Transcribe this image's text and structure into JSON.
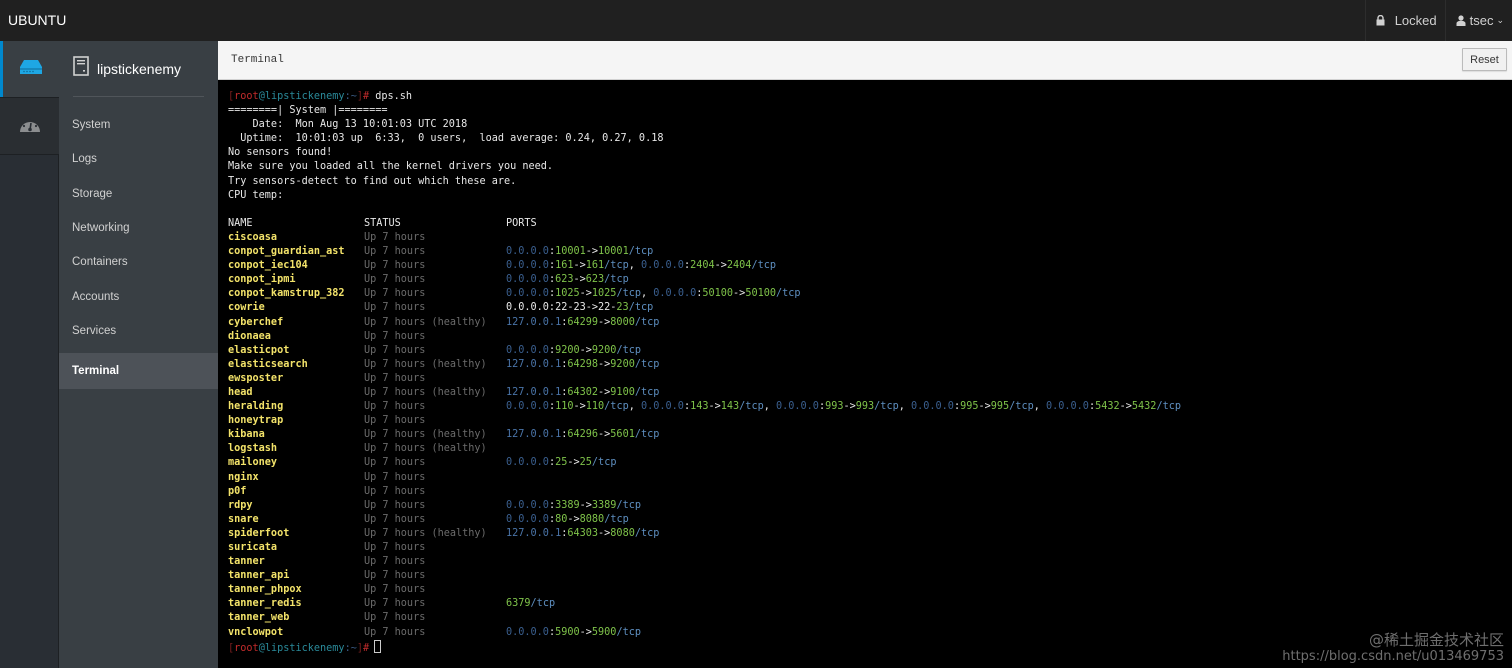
{
  "topbar": {
    "brand": "UBUNTU",
    "lock_label": "Locked",
    "user_label": "tsec"
  },
  "rail": {
    "items": [
      {
        "icon": "server-icon",
        "active": true
      },
      {
        "icon": "dashboard-icon",
        "active": false
      }
    ]
  },
  "nav": {
    "host": "lipstickenemy",
    "items": [
      {
        "label": "System"
      },
      {
        "label": "Logs"
      },
      {
        "label": "Storage"
      },
      {
        "label": "Networking"
      },
      {
        "label": "Containers"
      },
      {
        "label": "Accounts"
      },
      {
        "label": "Services"
      },
      {
        "label": "Terminal",
        "active": true
      }
    ]
  },
  "main": {
    "title": "Terminal",
    "reset_label": "Reset"
  },
  "terminal": {
    "prompt": {
      "user": "root",
      "host": "lipstickenemy",
      "path": "~",
      "symbol": "#"
    },
    "command": "dps.sh",
    "header_lines": [
      "========| System |========",
      "    Date:  Mon Aug 13 10:01:03 UTC 2018",
      "  Uptime:  10:01:03 up  6:33,  0 users,  load average: 0.24, 0.27, 0.18",
      "No sensors found!",
      "Make sure you loaded all the kernel drivers you need.",
      "Try sensors-detect to find out which these are.",
      "CPU temp:",
      ""
    ],
    "columns": {
      "name": "NAME",
      "status": "STATUS",
      "ports": "PORTS"
    },
    "containers": [
      {
        "name": "ciscoasa",
        "status": "Up 7 hours",
        "ports": []
      },
      {
        "name": "conpot_guardian_ast",
        "status": "Up 7 hours",
        "ports": [
          {
            "ip": "0.0.0.0",
            "host": "10001",
            "ctr": "10001",
            "proto": "tcp"
          }
        ]
      },
      {
        "name": "conpot_iec104",
        "status": "Up 7 hours",
        "ports": [
          {
            "ip": "0.0.0.0",
            "host": "161",
            "ctr": "161",
            "proto": "tcp"
          },
          {
            "ip": "0.0.0.0",
            "host": "2404",
            "ctr": "2404",
            "proto": "tcp"
          }
        ]
      },
      {
        "name": "conpot_ipmi",
        "status": "Up 7 hours",
        "ports": [
          {
            "ip": "0.0.0.0",
            "host": "623",
            "ctr": "623",
            "proto": "tcp"
          }
        ]
      },
      {
        "name": "conpot_kamstrup_382",
        "status": "Up 7 hours",
        "ports": [
          {
            "ip": "0.0.0.0",
            "host": "1025",
            "ctr": "1025",
            "proto": "tcp"
          },
          {
            "ip": "0.0.0.0",
            "host": "50100",
            "ctr": "50100",
            "proto": "tcp"
          }
        ]
      },
      {
        "name": "cowrie",
        "status": "Up 7 hours",
        "raw_ports": "0.0.0.0:22-23->22-23/tcp"
      },
      {
        "name": "cyberchef",
        "status": "Up 7 hours (healthy)",
        "ports": [
          {
            "ip": "127.0.0.1",
            "host": "64299",
            "ctr": "8000",
            "proto": "tcp"
          }
        ]
      },
      {
        "name": "dionaea",
        "status": "Up 7 hours",
        "ports": []
      },
      {
        "name": "elasticpot",
        "status": "Up 7 hours",
        "ports": [
          {
            "ip": "0.0.0.0",
            "host": "9200",
            "ctr": "9200",
            "proto": "tcp"
          }
        ]
      },
      {
        "name": "elasticsearch",
        "status": "Up 7 hours (healthy)",
        "ports": [
          {
            "ip": "127.0.0.1",
            "host": "64298",
            "ctr": "9200",
            "proto": "tcp"
          }
        ]
      },
      {
        "name": "ewsposter",
        "status": "Up 7 hours",
        "ports": []
      },
      {
        "name": "head",
        "status": "Up 7 hours (healthy)",
        "ports": [
          {
            "ip": "127.0.0.1",
            "host": "64302",
            "ctr": "9100",
            "proto": "tcp"
          }
        ]
      },
      {
        "name": "heralding",
        "status": "Up 7 hours",
        "ports": [
          {
            "ip": "0.0.0.0",
            "host": "110",
            "ctr": "110",
            "proto": "tcp"
          },
          {
            "ip": "0.0.0.0",
            "host": "143",
            "ctr": "143",
            "proto": "tcp"
          },
          {
            "ip": "0.0.0.0",
            "host": "993",
            "ctr": "993",
            "proto": "tcp"
          },
          {
            "ip": "0.0.0.0",
            "host": "995",
            "ctr": "995",
            "proto": "tcp"
          },
          {
            "ip": "0.0.0.0",
            "host": "5432",
            "ctr": "5432",
            "proto": "tcp"
          }
        ]
      },
      {
        "name": "honeytrap",
        "status": "Up 7 hours",
        "ports": []
      },
      {
        "name": "kibana",
        "status": "Up 7 hours (healthy)",
        "ports": [
          {
            "ip": "127.0.0.1",
            "host": "64296",
            "ctr": "5601",
            "proto": "tcp"
          }
        ]
      },
      {
        "name": "logstash",
        "status": "Up 7 hours (healthy)",
        "ports": []
      },
      {
        "name": "mailoney",
        "status": "Up 7 hours",
        "ports": [
          {
            "ip": "0.0.0.0",
            "host": "25",
            "ctr": "25",
            "proto": "tcp"
          }
        ]
      },
      {
        "name": "nginx",
        "status": "Up 7 hours",
        "ports": []
      },
      {
        "name": "p0f",
        "status": "Up 7 hours",
        "ports": []
      },
      {
        "name": "rdpy",
        "status": "Up 7 hours",
        "ports": [
          {
            "ip": "0.0.0.0",
            "host": "3389",
            "ctr": "3389",
            "proto": "tcp"
          }
        ]
      },
      {
        "name": "snare",
        "status": "Up 7 hours",
        "ports": [
          {
            "ip": "0.0.0.0",
            "host": "80",
            "ctr": "8080",
            "proto": "tcp"
          }
        ]
      },
      {
        "name": "spiderfoot",
        "status": "Up 7 hours (healthy)",
        "ports": [
          {
            "ip": "127.0.0.1",
            "host": "64303",
            "ctr": "8080",
            "proto": "tcp"
          }
        ]
      },
      {
        "name": "suricata",
        "status": "Up 7 hours",
        "ports": []
      },
      {
        "name": "tanner",
        "status": "Up 7 hours",
        "ports": []
      },
      {
        "name": "tanner_api",
        "status": "Up 7 hours",
        "ports": []
      },
      {
        "name": "tanner_phpox",
        "status": "Up 7 hours",
        "ports": []
      },
      {
        "name": "tanner_redis",
        "status": "Up 7 hours",
        "ports": [
          {
            "ctr": "6379",
            "proto": "tcp"
          }
        ]
      },
      {
        "name": "tanner_web",
        "status": "Up 7 hours",
        "ports": []
      },
      {
        "name": "vnclowpot",
        "status": "Up 7 hours",
        "ports": [
          {
            "ip": "0.0.0.0",
            "host": "5900",
            "ctr": "5900",
            "proto": "tcp"
          }
        ]
      }
    ]
  },
  "watermark": {
    "line1": "@稀土掘金技术社区",
    "line2": "https://blog.csdn.net/u013469753"
  }
}
